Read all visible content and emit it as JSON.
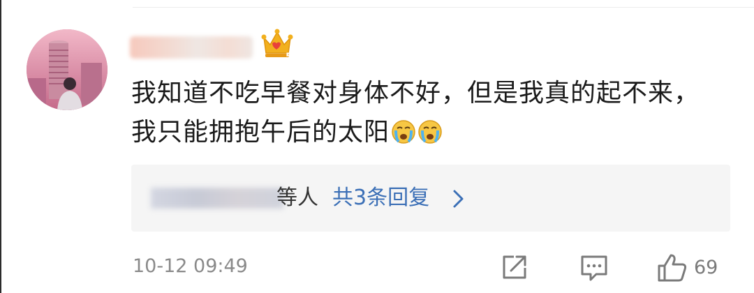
{
  "comment": {
    "username": "▒▒▒▒▒▒▒▒",
    "badge_level": "5",
    "text": "我知道不吃早餐对身体不好，但是我真的起不来，我只能拥抱午后的太阳",
    "emoji": [
      "crying-emoji",
      "crying-emoji"
    ]
  },
  "replies": {
    "names": "▒▒▒▒▒▒▒▒",
    "suffix": "等人",
    "count_label": "共3条回复",
    "chevron": ">"
  },
  "footer": {
    "timestamp": "10-12 09:49",
    "like_count": "69",
    "icons": [
      "share-icon",
      "comment-icon",
      "like-icon"
    ]
  },
  "colors": {
    "link": "#3b6fb6",
    "muted": "#8a8a8a",
    "reply_bg": "#f5f5f5",
    "crown_gold": "#f2b01e"
  }
}
